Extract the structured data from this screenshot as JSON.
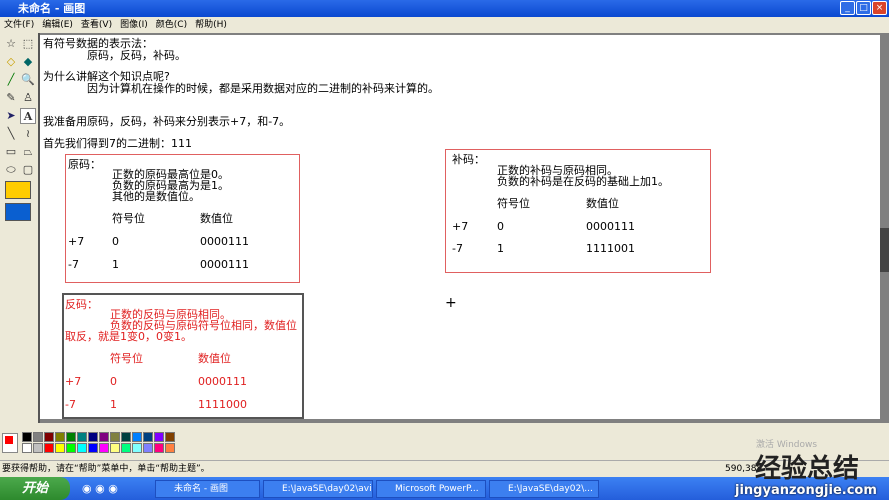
{
  "window": {
    "title": "未命名 - 画图",
    "min": "_",
    "max": "□",
    "close": "×"
  },
  "menu": [
    "文件(F)",
    "编辑(E)",
    "查看(V)",
    "图像(I)",
    "颜色(C)",
    "帮助(H)"
  ],
  "canvas": {
    "line1": "有符号数据的表示法：",
    "line2": "原码，反码，补码。",
    "line3": "为什么讲解这个知识点呢?",
    "line4": "因为计算机在操作的时候，都是采用数据对应的二进制的补码来计算的。",
    "line5": "我准备用原码，反码，补码来分别表示+7，和-7。",
    "line6": "首先我们得到7的二进制：111",
    "yuanma": {
      "title": "原码：",
      "d1": "正数的原码最高位是0。",
      "d2": "负数的原码最高为是1。",
      "d3": "其他的是数值位。",
      "h1": "符号位",
      "h2": "数值位",
      "rows": [
        [
          "+7",
          "0",
          "0000111"
        ],
        [
          "-7",
          "1",
          "0000111"
        ]
      ]
    },
    "fanma": {
      "title": "反码：",
      "d1": "正数的反码与原码相同。",
      "d2": "负数的反码与原码符号位相同，数值位",
      "d3": "取反，就是1变0，0变1。",
      "h1": "符号位",
      "h2": "数值位",
      "rows": [
        [
          "+7",
          "0",
          "0000111"
        ],
        [
          "-7",
          "1",
          "1111000"
        ]
      ]
    },
    "buma": {
      "title": "补码：",
      "d1": "正数的补码与原码相同。",
      "d2": "负数的补码是在反码的基础上加1。",
      "h1": "符号位",
      "h2": "数值位",
      "rows": [
        [
          "+7",
          "0",
          "0000111"
        ],
        [
          "-7",
          "1",
          "1111001"
        ]
      ]
    }
  },
  "palette": {
    "colors": [
      "#000000",
      "#808080",
      "#800000",
      "#808000",
      "#008000",
      "#008080",
      "#000080",
      "#800080",
      "#808040",
      "#004040",
      "#0080ff",
      "#004080",
      "#8000ff",
      "#804000",
      "#ffffff",
      "#c0c0c0",
      "#ff0000",
      "#ffff00",
      "#00ff00",
      "#00ffff",
      "#0000ff",
      "#ff00ff",
      "#ffff80",
      "#00ff80",
      "#80ffff",
      "#8080ff",
      "#ff0080",
      "#ff8040"
    ],
    "foreground": "#ff0000"
  },
  "status": {
    "help": "要获得帮助，请在“帮助”菜单中，单击“帮助主题”。",
    "coords": "590,388",
    "activate": "激活 Windows"
  },
  "taskbar": {
    "start": "开始",
    "tasks": [
      "未命名 - 画图",
      "E:\\JavaSE\\day02\\avi",
      "Microsoft PowerP...",
      "E:\\JavaSE\\day02\\..."
    ]
  },
  "watermark": {
    "cn": "经验总结",
    "url": "jingyanzongjie.com"
  }
}
